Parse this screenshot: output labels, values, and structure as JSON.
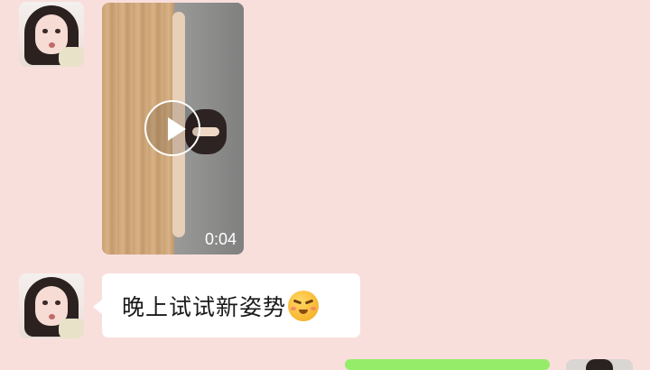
{
  "chat": {
    "messages": [
      {
        "type": "video",
        "sender_avatar": "contact-avatar",
        "duration": "0:04",
        "icon": "play-icon"
      },
      {
        "type": "text",
        "sender_avatar": "contact-avatar",
        "text": "晚上试试新姿势",
        "emoji": "smirk-blush-emoji"
      }
    ],
    "outgoing_partial": {
      "bubble_color": "#95ec69"
    }
  },
  "colors": {
    "background": "#f9dfdc",
    "incoming_bubble": "#ffffff",
    "outgoing_bubble": "#95ec69"
  }
}
